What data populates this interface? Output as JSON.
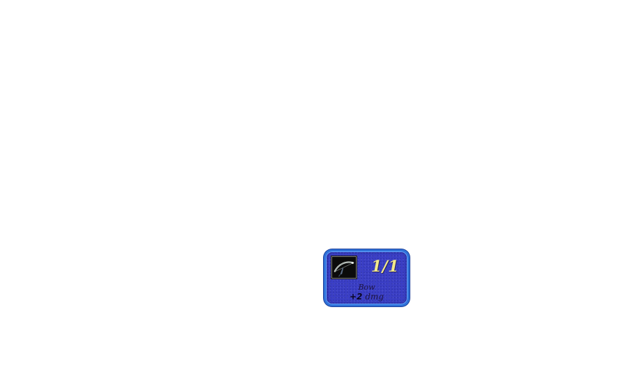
{
  "unit_card": {
    "icon": "bow-icon",
    "count": "1/1",
    "name": "Bow",
    "bonus_value": "+2",
    "bonus_unit": "dmg",
    "colors": {
      "card_fill": "#3b3fc6",
      "card_border": "#2f73d9",
      "count_text": "#f3e98a"
    }
  }
}
